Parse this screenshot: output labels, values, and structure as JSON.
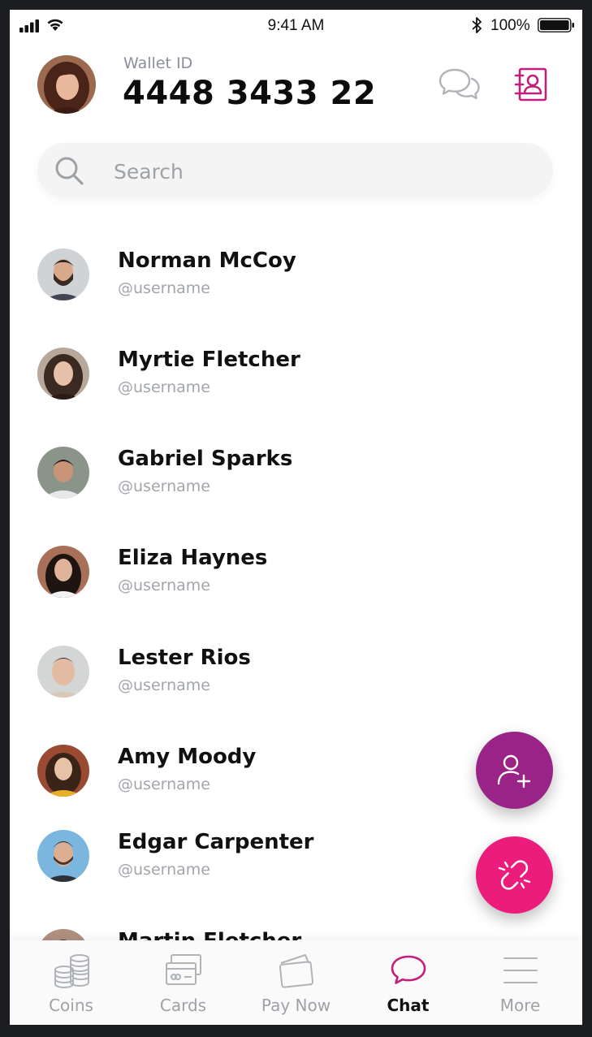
{
  "status_bar": {
    "time": "9:41 AM",
    "battery": "100%"
  },
  "header": {
    "wallet_label": "Wallet ID",
    "wallet_id": "4448 3433 22"
  },
  "search": {
    "placeholder": "Search"
  },
  "contacts": [
    {
      "name": "Norman McCoy",
      "handle": "@username"
    },
    {
      "name": "Myrtie Fletcher",
      "handle": "@username"
    },
    {
      "name": "Gabriel Sparks",
      "handle": "@username"
    },
    {
      "name": "Eliza Haynes",
      "handle": "@username"
    },
    {
      "name": "Lester Rios",
      "handle": "@username"
    },
    {
      "name": "Amy Moody",
      "handle": "@username"
    },
    {
      "name": "Edgar Carpenter",
      "handle": "@username"
    },
    {
      "name": "Martin Fletcher",
      "handle": ""
    }
  ],
  "tabs": [
    {
      "label": "Coins",
      "icon": "coins-icon",
      "active": false
    },
    {
      "label": "Cards",
      "icon": "cards-icon",
      "active": false
    },
    {
      "label": "Pay Now",
      "icon": "wallet-icon",
      "active": false
    },
    {
      "label": "Chat",
      "icon": "chat-icon",
      "active": true
    },
    {
      "label": "More",
      "icon": "menu-icon",
      "active": false
    }
  ],
  "colors": {
    "accent_magenta": "#c21e7c",
    "fab_purple": "#9a2388",
    "fab_pink": "#ec1c7c",
    "muted_text": "#9ea2a7"
  }
}
